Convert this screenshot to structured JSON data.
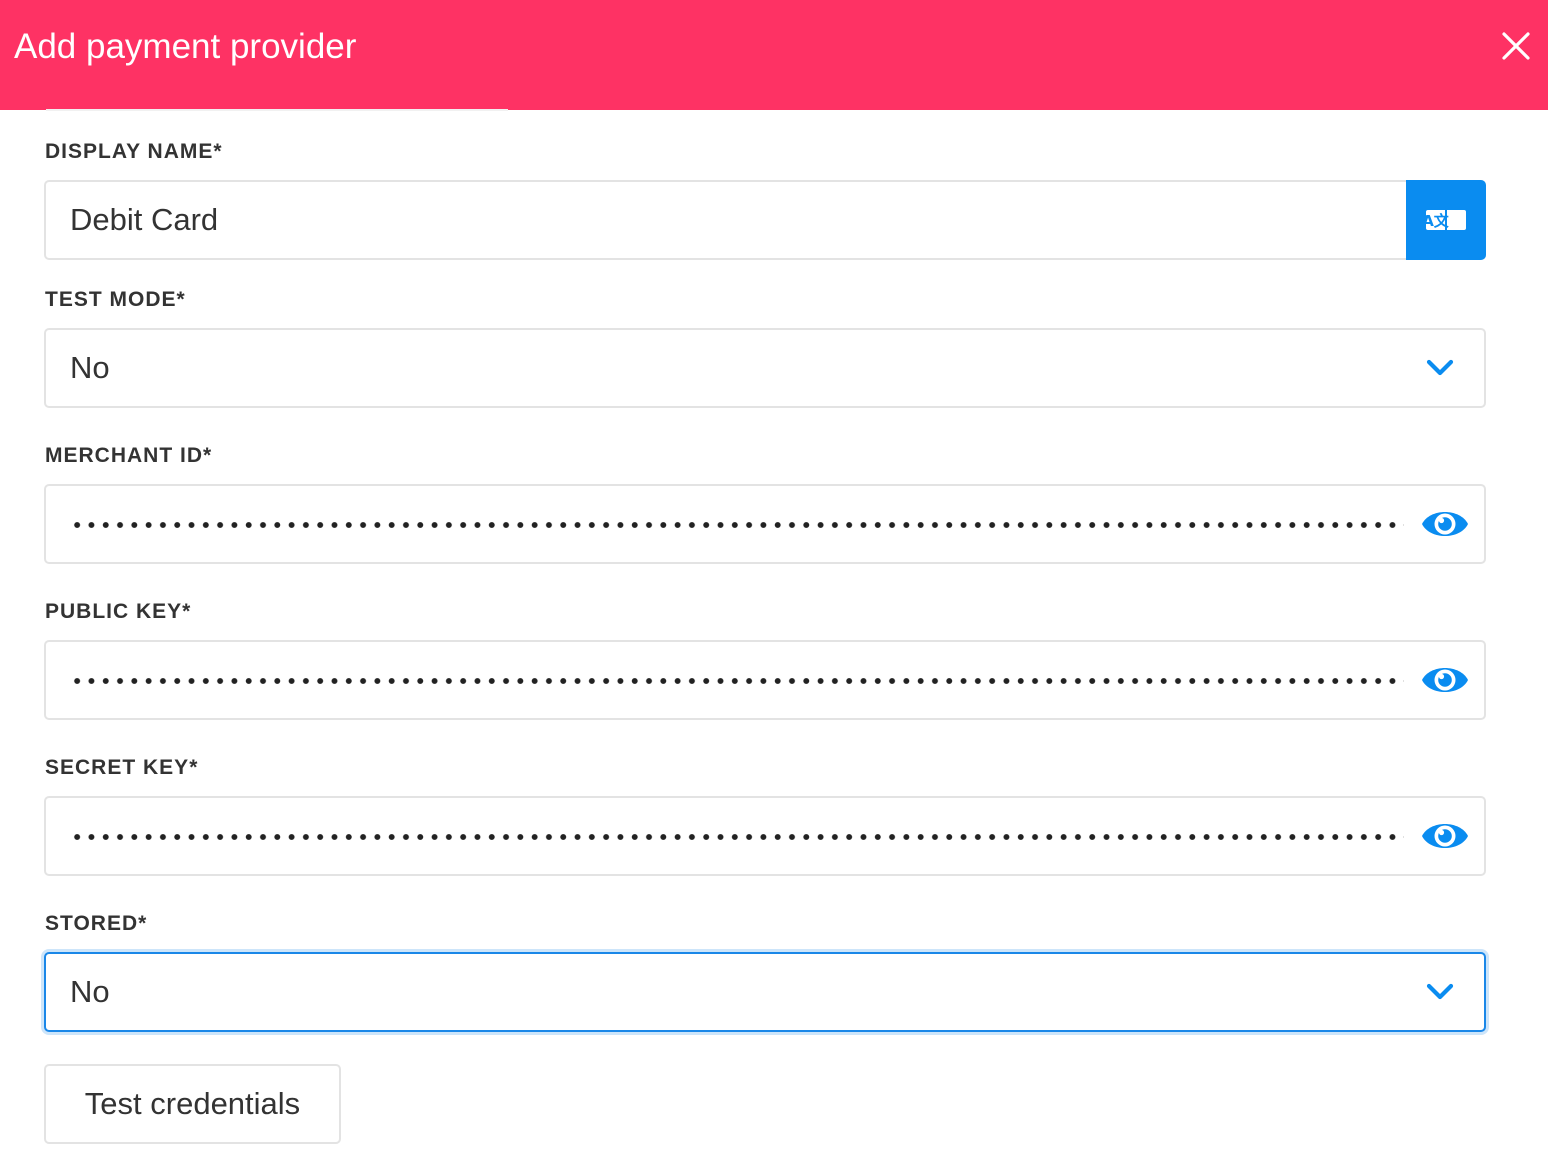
{
  "dialog": {
    "title": "Add payment provider",
    "close_icon": "close-icon",
    "header_color": "#fe3264"
  },
  "fields": {
    "display_name": {
      "label": "DISPLAY NAME*",
      "value": "Debit Card",
      "action_icon": "translate-icon",
      "translate_icon_text": "A文"
    },
    "test_mode": {
      "label": "TEST MODE*",
      "value": "No",
      "icon": "chevron-down-icon"
    },
    "merchant_id": {
      "label": "MERCHANT ID*",
      "masked": true,
      "icon": "eye-icon"
    },
    "public_key": {
      "label": "PUBLIC KEY*",
      "masked": true,
      "icon": "eye-icon"
    },
    "secret_key": {
      "label": "SECRET KEY*",
      "masked": true,
      "icon": "eye-icon"
    },
    "stored": {
      "label": "STORED*",
      "value": "No",
      "icon": "chevron-down-icon",
      "focused": true
    }
  },
  "actions": {
    "test_credentials_label": "Test credentials"
  },
  "colors": {
    "accent": "#0a8cf0",
    "focus": "#1a87e8",
    "text": "#333333"
  }
}
